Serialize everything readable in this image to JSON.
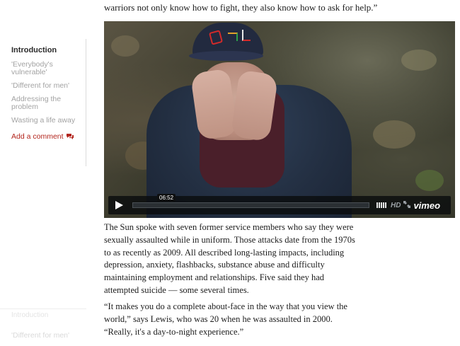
{
  "sidebar": {
    "items": [
      {
        "label": "Introduction",
        "active": true
      },
      {
        "label": "'Everybody's vulnerable'",
        "active": false
      },
      {
        "label": "'Different for men'",
        "active": false
      },
      {
        "label": "Addressing the problem",
        "active": false
      },
      {
        "label": "Wasting a life away",
        "active": false
      }
    ],
    "comment_label": "Add a comment",
    "comment_icon": "speech-bubbles-icon",
    "ghost_top": "Introduction",
    "ghost_bottom": "'Different for men'"
  },
  "article": {
    "lead_line": "warriors not only know how to fight, they also know how to ask for help.”",
    "paragraph_1": "The Sun spoke with seven former service members who say they were sexually assaulted while in uniform. Those attacks date from the 1970s to as recently as 2009. All described long-lasting impacts, including depression, anxiety, flashbacks, substance abuse and difficulty maintaining employment and relationships. Five said they had attempted suicide — some several times.",
    "paragraph_2": "“It makes you do a complete about-face in the way that you view the world,” says Lewis, who was 20 when he was assaulted in 2000. “Really, it's a day-to-night experience.”"
  },
  "video": {
    "duration": "06:52",
    "progress": 0,
    "hd_label": "HD",
    "brand": "vimeo",
    "icons": [
      "play-icon",
      "volume-bars-icon",
      "fullscreen-icon"
    ]
  },
  "colors": {
    "accent": "#b3261e",
    "muted": "#a3a3a3",
    "active": "#2b2b2b",
    "controls_bg": "#0e0f10"
  }
}
